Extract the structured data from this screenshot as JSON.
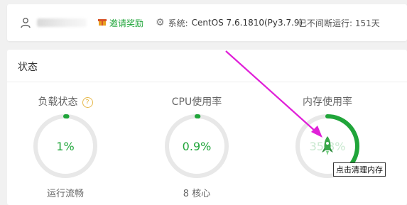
{
  "topbar": {
    "user_icon": "user-icon",
    "invite_icon": "gift-icon",
    "invite_label": "邀请奖励",
    "system_icon": "gear-icon",
    "system_label": "系统:",
    "system_value": "CentOS 7.6.1810(Py3.7.9)",
    "uptime_label": "已不间断运行: 151天"
  },
  "status": {
    "title": "状态",
    "gauges": [
      {
        "label": "负载状态",
        "value": "1%",
        "percent": 0.01,
        "sub": "运行流畅",
        "help": "?"
      },
      {
        "label": "CPU使用率",
        "value": "0.9%",
        "percent": 0.009,
        "sub": "8 核心"
      },
      {
        "label": "内存使用率",
        "value": "35.8%",
        "percent": 0.358,
        "sub": ""
      }
    ],
    "tooltip": "点击清理内存"
  },
  "colors": {
    "accent": "#20a53a",
    "track": "#e8e8e8",
    "annotation": "#e020d8"
  }
}
